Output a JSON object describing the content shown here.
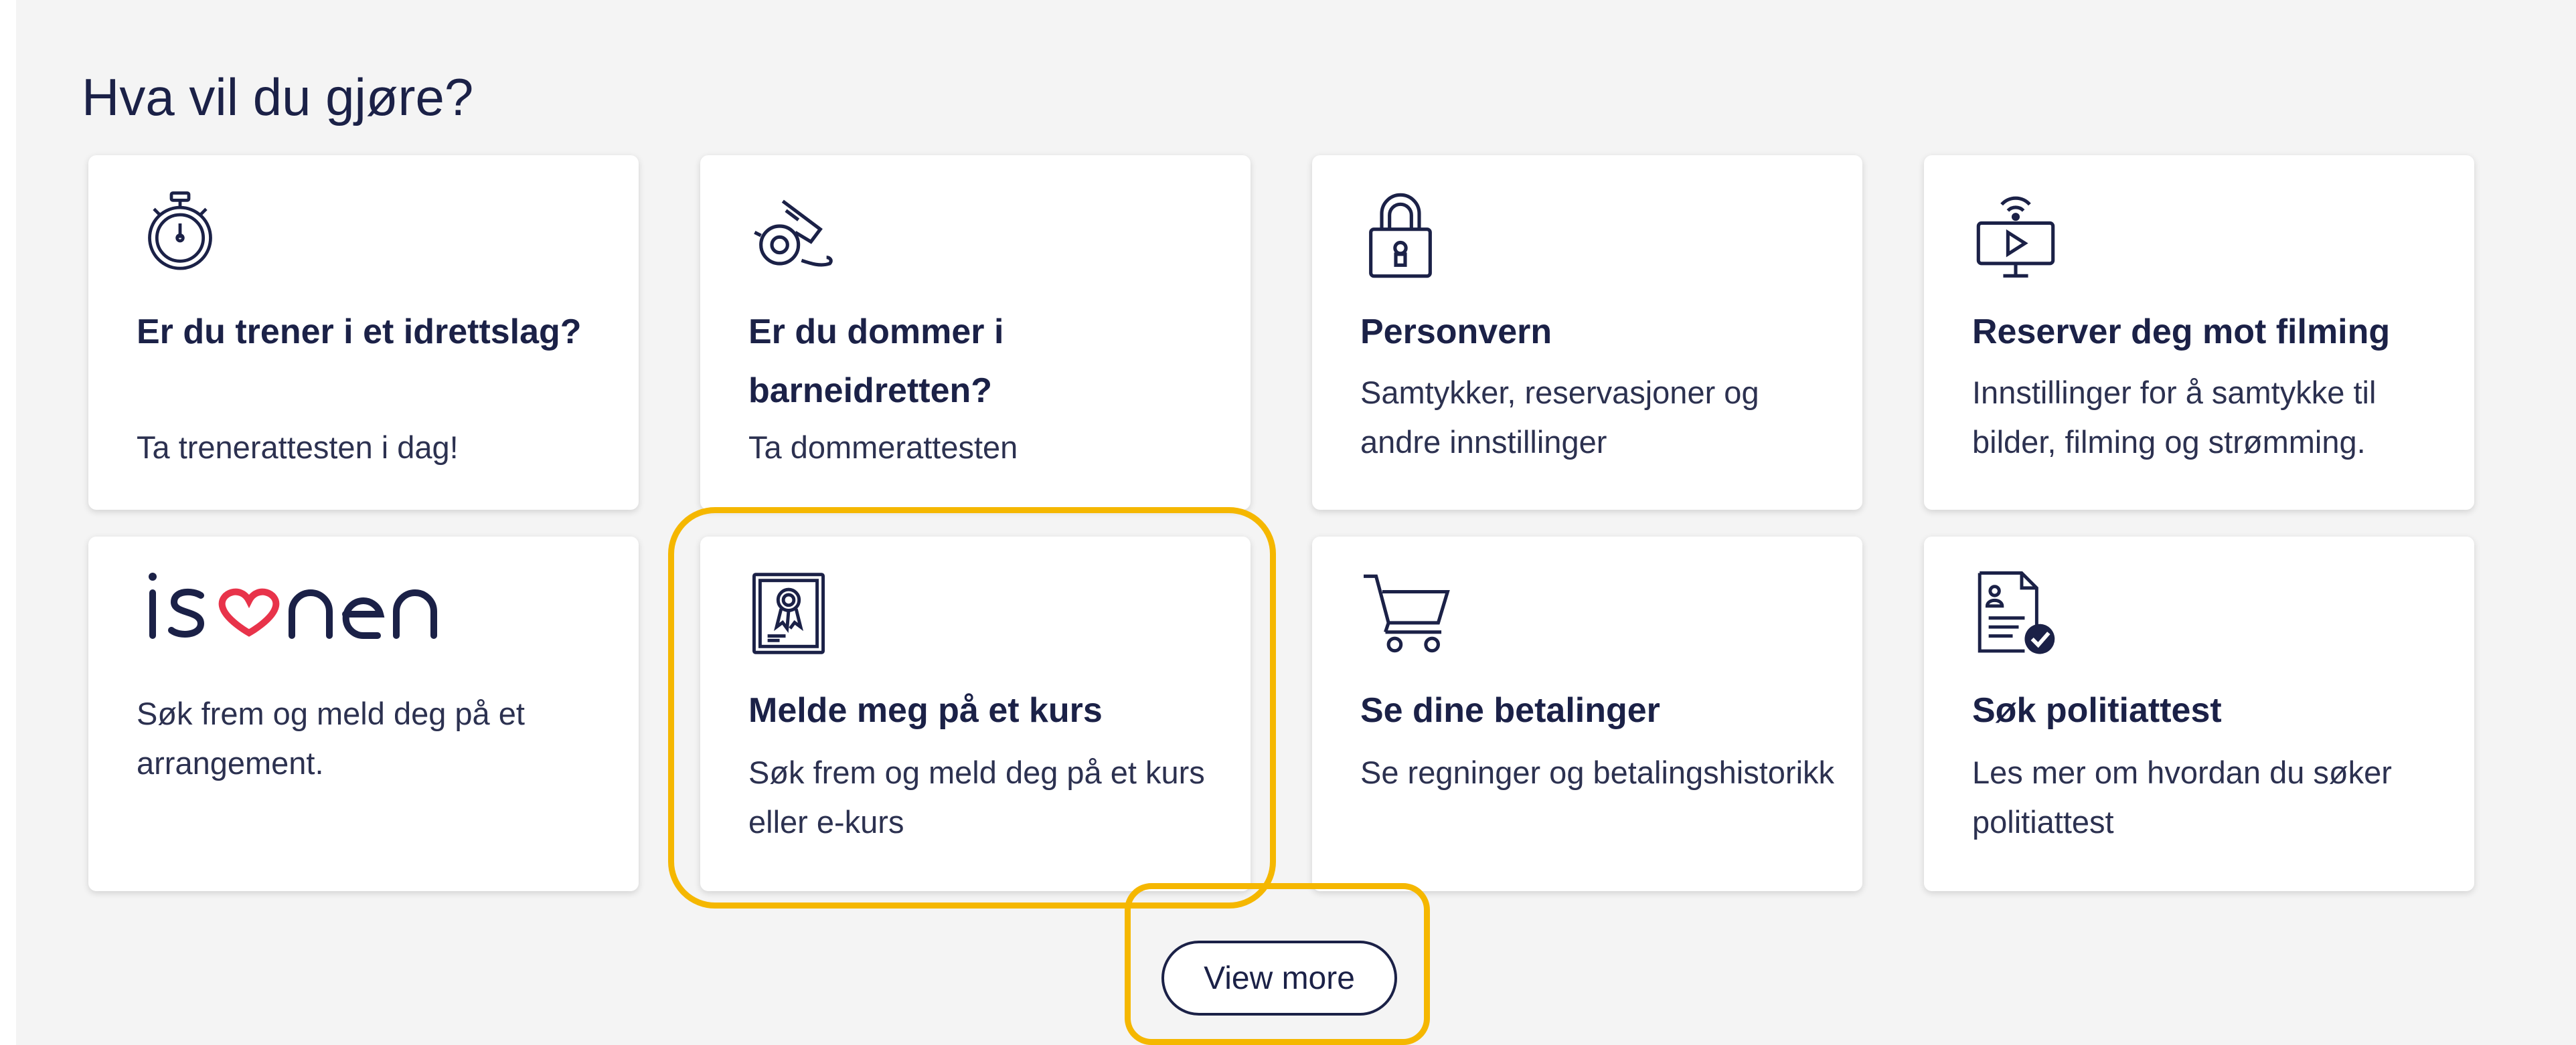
{
  "heading": "Hva vil du gjøre?",
  "cards": [
    {
      "icon": "stopwatch-icon",
      "title": "Er du trener i et idrettslag?",
      "desc": "Ta trenerattesten i dag!"
    },
    {
      "icon": "whistle-icon",
      "title": "Er du dommer i barneidretten?",
      "desc": "Ta dommerattesten"
    },
    {
      "icon": "padlock-icon",
      "title": "Personvern",
      "desc": "Samtykker, reservasjoner og andre innstillinger"
    },
    {
      "icon": "streaming-screen-icon",
      "title": "Reserver deg mot filming",
      "desc": "Innstillinger for å samtykke til bilder, filming og strømming."
    },
    {
      "logo_text": "isonen",
      "desc": "Søk frem og meld deg på et arrangement."
    },
    {
      "icon": "certificate-icon",
      "title": "Melde meg på et kurs",
      "desc": "Søk frem og meld deg på et kurs eller e-kurs"
    },
    {
      "icon": "shopping-cart-icon",
      "title": "Se dine betalinger",
      "desc": "Se regninger og betalingshistorikk"
    },
    {
      "icon": "document-check-icon",
      "title": "Søk politiattest",
      "desc": "Les mer om hvordan du søker politiattest"
    }
  ],
  "view_more_label": "View more",
  "colors": {
    "text": "#1b2147",
    "highlight": "#f5b700",
    "background": "#f4f4f4",
    "logo_heart": "#e8334a"
  }
}
